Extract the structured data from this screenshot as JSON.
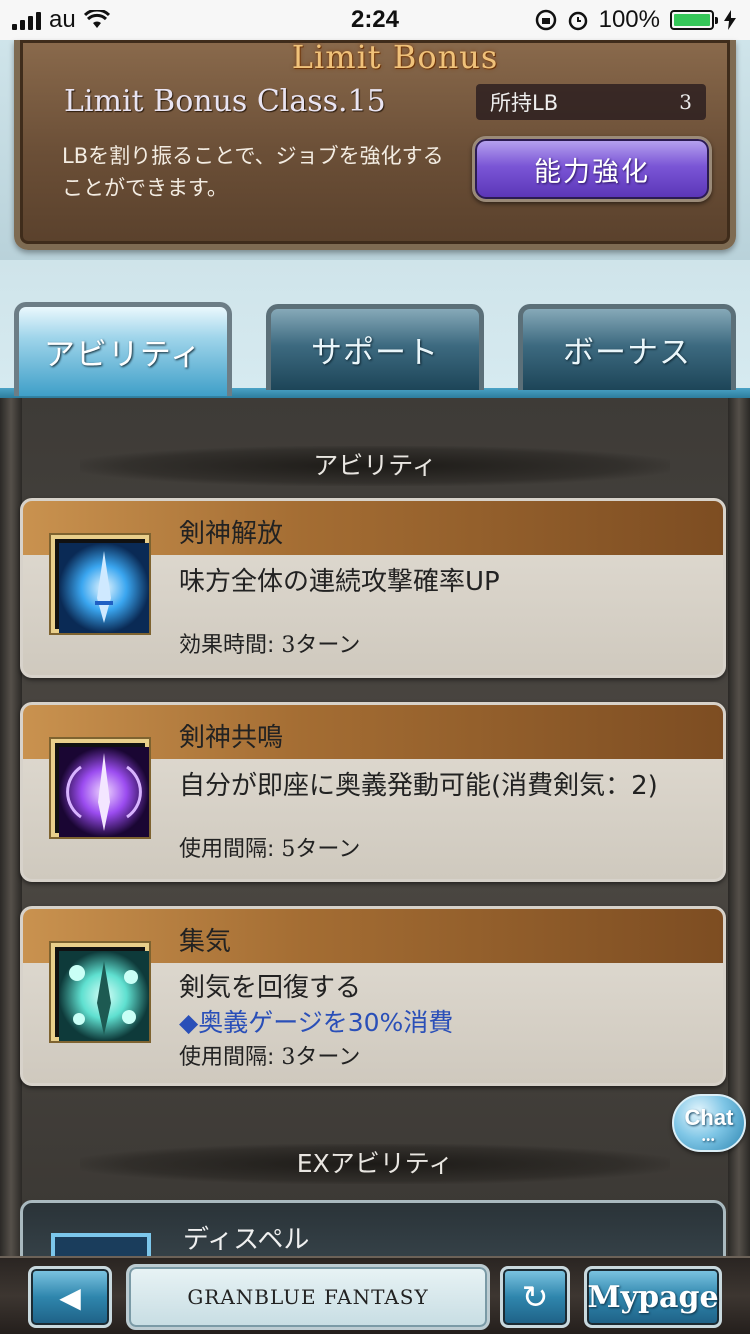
{
  "status_bar": {
    "carrier": "au",
    "time": "2:24",
    "battery": "100%"
  },
  "limit_bonus": {
    "logo": "Limit Bonus",
    "class_label": "Limit Bonus Class.15",
    "owned_label": "所持LB",
    "owned_value": "3",
    "description": "LBを割り振ることで、ジョブを強化することができます。",
    "enhance_button": "能力強化"
  },
  "tabs": [
    {
      "label": "アビリティ",
      "active": true
    },
    {
      "label": "サポート",
      "active": false
    },
    {
      "label": "ボーナス",
      "active": false
    }
  ],
  "sections": {
    "abilities_title": "アビリティ",
    "ex_title": "EXアビリティ"
  },
  "abilities": [
    {
      "name": "剣神解放",
      "description": "味方全体の連続攻撃確率UP",
      "description_extra": "",
      "meta_label": "効果時間:",
      "meta_value": "3ターン",
      "icon": "sword-blue-burst-icon",
      "icon_color": "#3aa6f0"
    },
    {
      "name": "剣神共鳴",
      "description": "自分が即座に奥義発動可能(消費剣気：2)",
      "description_extra": "",
      "meta_label": "使用間隔:",
      "meta_value": "5ターン",
      "icon": "sword-purple-aura-icon",
      "icon_color": "#9b4cf0"
    },
    {
      "name": "集気",
      "description": "剣気を回復する",
      "description_extra": "◆奥義ゲージを30%消費",
      "meta_label": "使用間隔:",
      "meta_value": "3ターン",
      "icon": "sword-teal-orbs-icon",
      "icon_color": "#5fe0d0"
    }
  ],
  "ex_abilities": [
    {
      "name": "ディスペル",
      "icon": "dispel-icon"
    }
  ],
  "chat": {
    "label": "Chat"
  },
  "bottom_nav": {
    "back_icon": "◀",
    "logo": "GRANBLUE FANTASY",
    "reload_icon": "↻",
    "mypage": "Mypage"
  }
}
